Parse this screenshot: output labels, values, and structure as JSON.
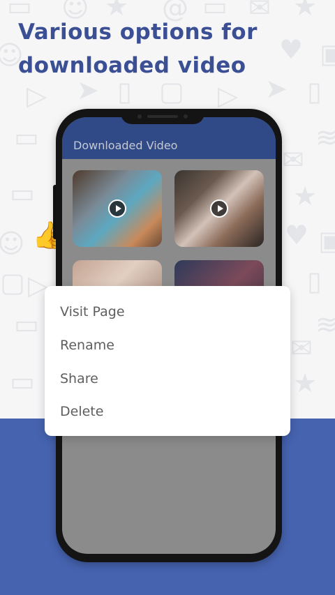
{
  "headline": {
    "line1": "Various options for",
    "line2": "downloaded video"
  },
  "app": {
    "title": "Downloaded Video"
  },
  "videos": [
    {
      "id_label": "video-thumbnail-1",
      "has_play": true
    },
    {
      "id_label": "video-thumbnail-2",
      "has_play": true
    },
    {
      "id_label": "video-thumbnail-3",
      "has_play": false
    },
    {
      "id_label": "video-thumbnail-4",
      "has_play": false
    }
  ],
  "menu": {
    "items": [
      {
        "label": "Visit Page"
      },
      {
        "label": "Rename"
      },
      {
        "label": "Share"
      },
      {
        "label": "Delete"
      }
    ]
  },
  "colors": {
    "brand_blue": "#4663b0",
    "headline": "#3b4f95",
    "appbar": "#2f4a86"
  }
}
